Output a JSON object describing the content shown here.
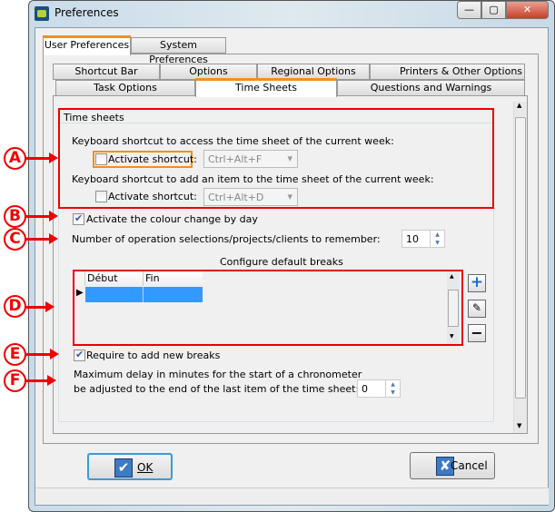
{
  "window": {
    "title": "Preferences",
    "minimize": "—",
    "maximize": "▢",
    "close": "✕"
  },
  "outer_tabs": [
    {
      "label": "User Preferences",
      "selected": true
    },
    {
      "label": "System Preferences",
      "selected": false
    }
  ],
  "inner_tabs_row1": [
    "Shortcut Bar",
    "Options",
    "Regional Options",
    "Printers & Other Options"
  ],
  "inner_tabs_row2": [
    "Task Options",
    "Time Sheets",
    "Questions and Warnings"
  ],
  "selected_inner_tab": "Time Sheets",
  "group": {
    "title": "Time sheets",
    "shortcut1": {
      "label": "Keyboard shortcut to access the time sheet of the current week:",
      "checkbox": "Activate shortcut:",
      "checked": false,
      "value": "Ctrl+Alt+F"
    },
    "shortcut2": {
      "label": "Keyboard shortcut to add an item to the time sheet of the current week:",
      "checkbox": "Activate shortcut:",
      "checked": false,
      "value": "Ctrl+Alt+D"
    }
  },
  "colour_change": {
    "label": "Activate the colour change by day",
    "checked": true
  },
  "remember": {
    "label": "Number of operation selections/projects/clients to remember:",
    "value": "10"
  },
  "breaks": {
    "title": "Configure default breaks",
    "columns": [
      "Début",
      "Fin"
    ],
    "rows": [
      [
        "",
        ""
      ]
    ]
  },
  "require_breaks": {
    "label": "Require to add new breaks",
    "checked": true
  },
  "max_delay": {
    "line1": "Maximum delay in minutes for the start of a chronometer",
    "line2": "be adjusted to the end of the last item of the time sheet:",
    "value": "0"
  },
  "buttons": {
    "ok": "OK",
    "cancel": "Cancel"
  },
  "annotations": [
    "A",
    "B",
    "C",
    "D",
    "E",
    "F"
  ],
  "colors": {
    "annotation": "#e00000",
    "selected_tab_accent": "#f0901e",
    "selected_row": "#3399ff"
  }
}
